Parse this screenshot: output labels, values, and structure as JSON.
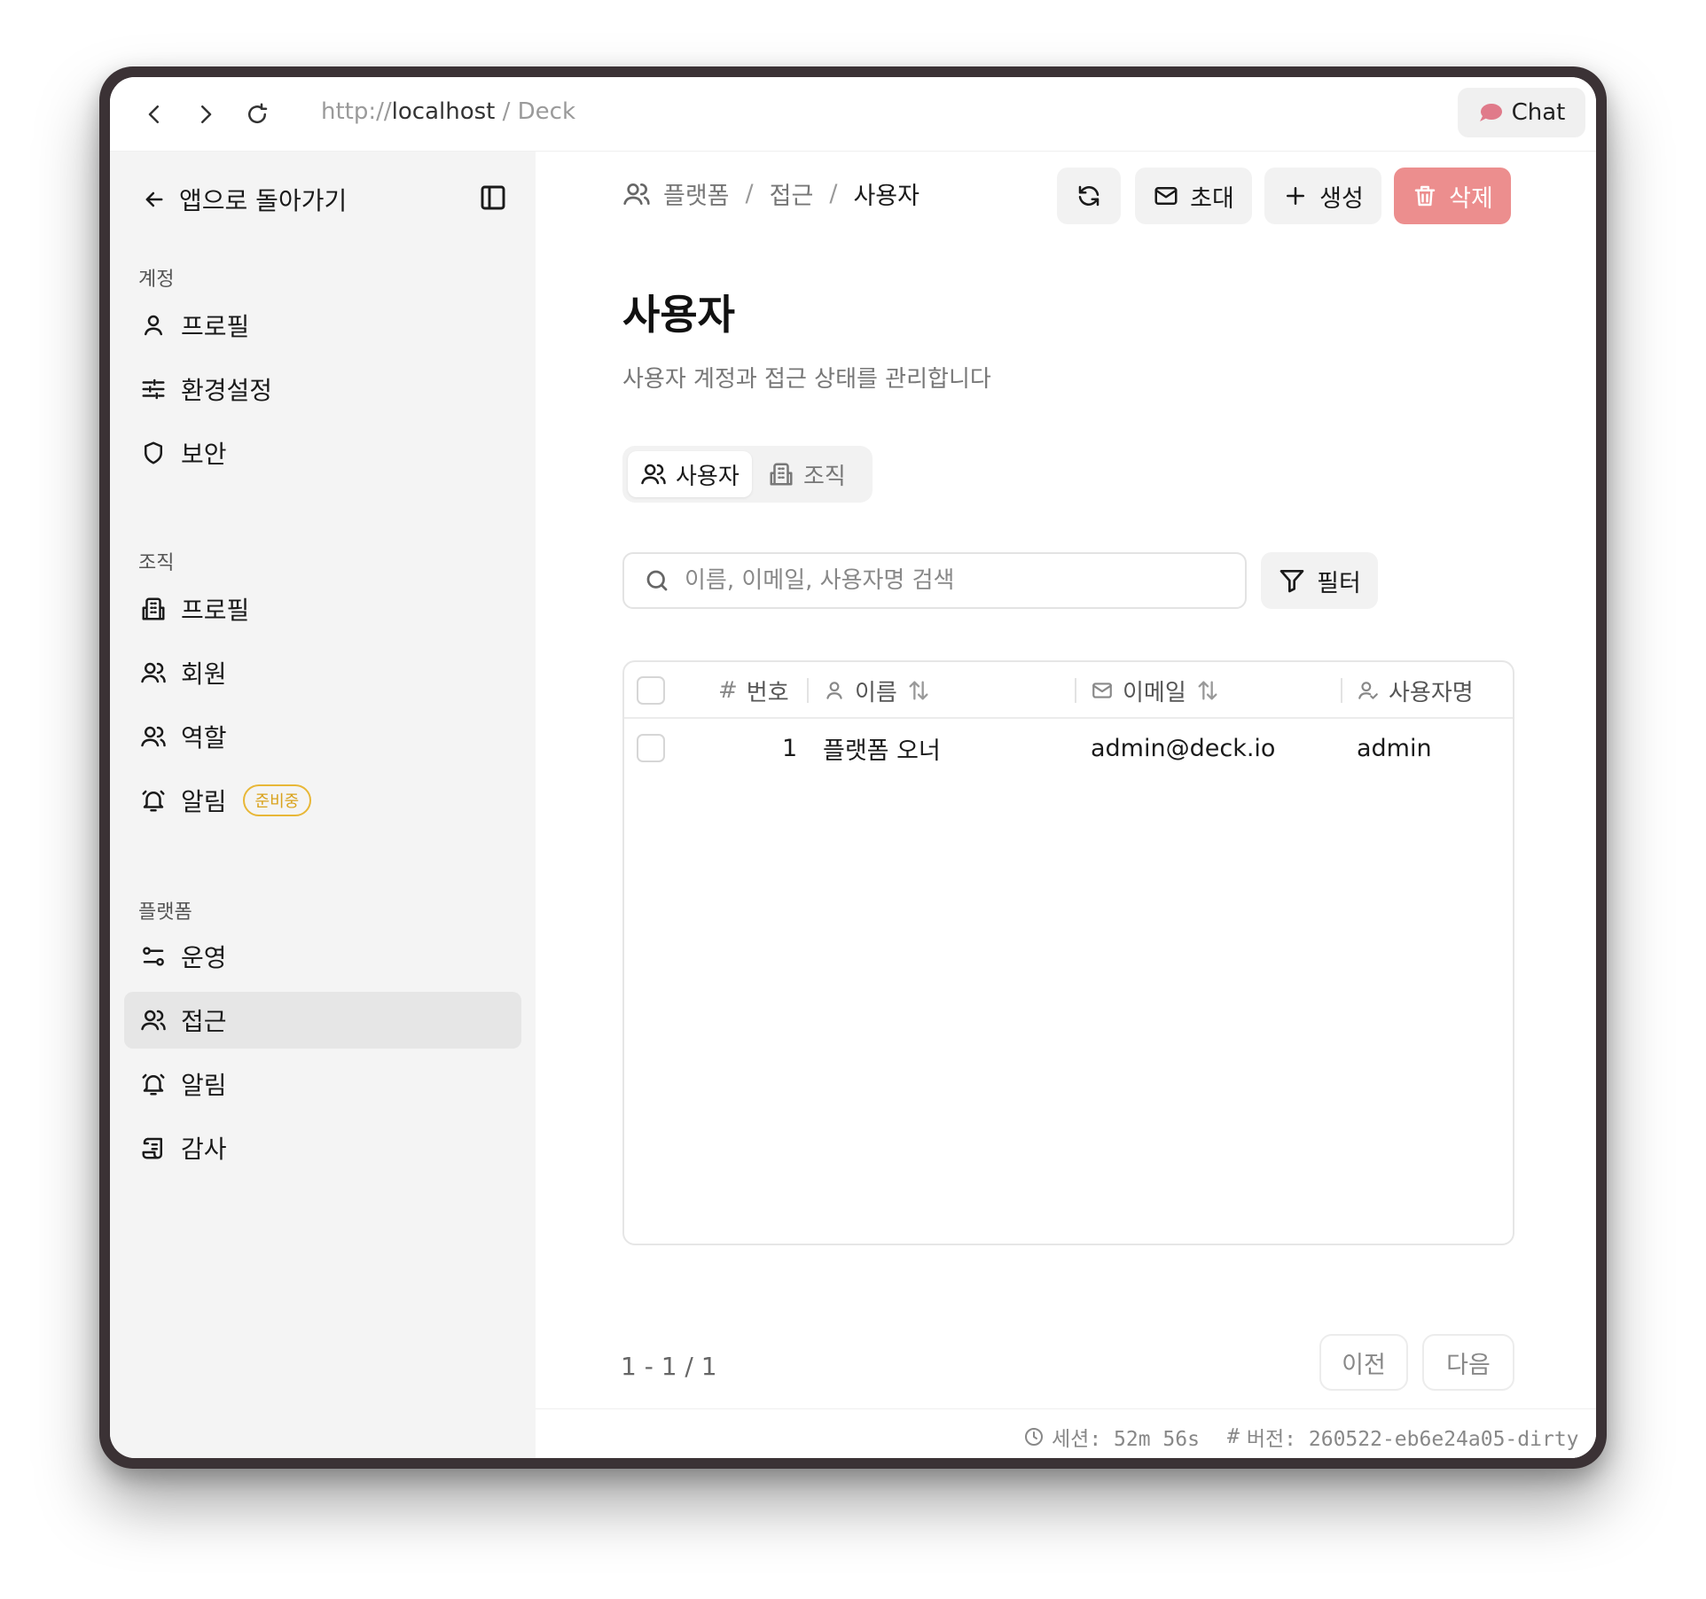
{
  "browser": {
    "url_scheme": "http://",
    "url_host": "localhost",
    "url_suffix": " / Deck",
    "chat_label": "Chat"
  },
  "sidebar": {
    "back_label": "앱으로 돌아가기",
    "sections": [
      {
        "label": "계정",
        "items": [
          {
            "label": "프로필",
            "icon": "user-icon"
          },
          {
            "label": "환경설정",
            "icon": "sliders-icon"
          },
          {
            "label": "보안",
            "icon": "shield-icon"
          }
        ]
      },
      {
        "label": "조직",
        "items": [
          {
            "label": "프로필",
            "icon": "building-icon"
          },
          {
            "label": "회원",
            "icon": "users-icon"
          },
          {
            "label": "역할",
            "icon": "users-icon"
          },
          {
            "label": "알림",
            "icon": "bell-icon",
            "badge": "준비중"
          }
        ]
      },
      {
        "label": "플랫폼",
        "items": [
          {
            "label": "운영",
            "icon": "toggles-icon"
          },
          {
            "label": "접근",
            "icon": "users-icon",
            "active": true
          },
          {
            "label": "알림",
            "icon": "bell-icon"
          },
          {
            "label": "감사",
            "icon": "scroll-icon"
          }
        ]
      }
    ]
  },
  "breadcrumb": {
    "items": [
      "플랫폼",
      "접근",
      "사용자"
    ],
    "separator": "/"
  },
  "toolbar": {
    "invite_label": "초대",
    "create_label": "생성",
    "delete_label": "삭제"
  },
  "page": {
    "title": "사용자",
    "description": "사용자 계정과 접근 상태를 관리합니다"
  },
  "tabs": [
    {
      "label": "사용자",
      "active": true
    },
    {
      "label": "조직",
      "active": false
    }
  ],
  "search": {
    "placeholder": "이름, 이메일, 사용자명 검색",
    "value": ""
  },
  "filter_label": "필터",
  "table": {
    "columns": [
      {
        "label": "번호",
        "prefix": "#"
      },
      {
        "label": "이름",
        "sortable": true
      },
      {
        "label": "이메일",
        "sortable": true
      },
      {
        "label": "사용자명"
      }
    ],
    "rows": [
      {
        "number": "1",
        "name": "플랫폼 오너",
        "email": "admin@deck.io",
        "username": "admin"
      }
    ]
  },
  "pagination": {
    "info": "1 - 1 / 1",
    "prev_label": "이전",
    "next_label": "다음"
  },
  "status": {
    "session_label": "세션: 52m 56s",
    "version_label": "버전: 260522-eb6e24a05-dirty"
  },
  "colors": {
    "danger": "#ec8e8e",
    "badge": "#e8b737",
    "chat_icon": "#e07a8a"
  }
}
